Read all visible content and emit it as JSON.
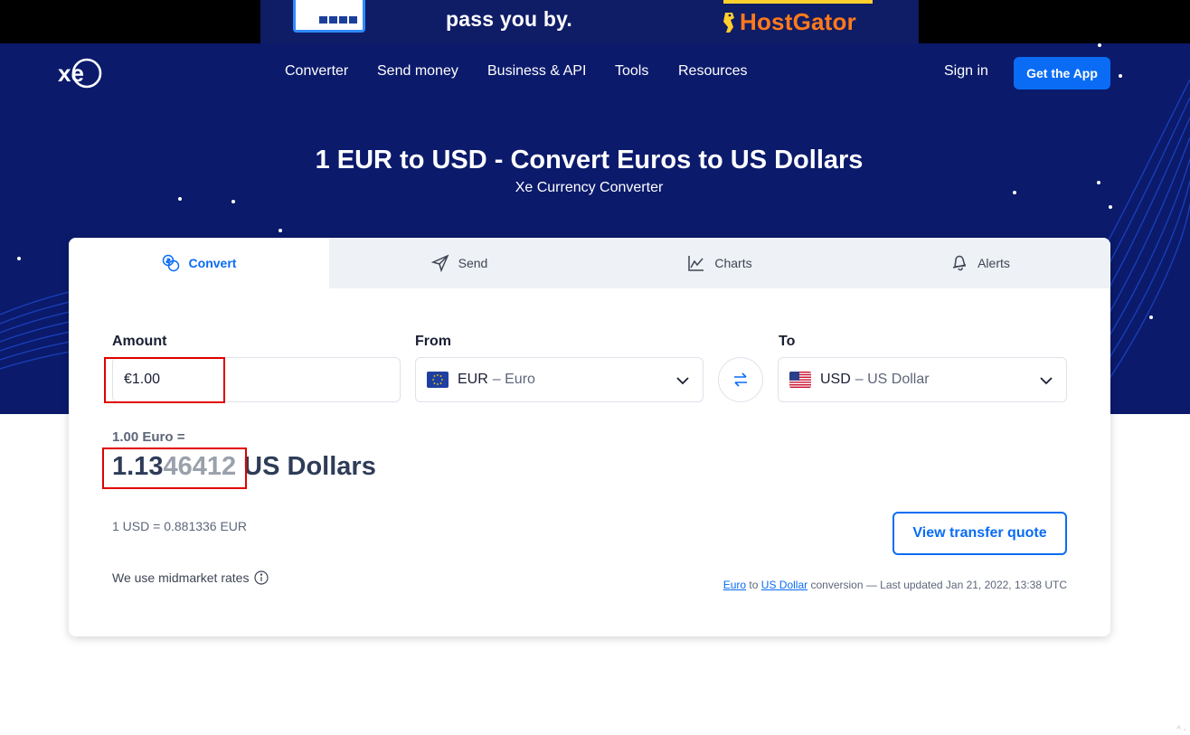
{
  "ad": {
    "headline": "pass you by.",
    "brand": "HostGator"
  },
  "header": {
    "nav": [
      "Converter",
      "Send money",
      "Business & API",
      "Tools",
      "Resources"
    ],
    "sign_in": "Sign in",
    "get_app": "Get the App"
  },
  "hero": {
    "title": "1 EUR to USD - Convert Euros to US Dollars",
    "subtitle": "Xe Currency Converter"
  },
  "tabs": [
    {
      "label": "Convert",
      "icon": "convert-icon",
      "active": true
    },
    {
      "label": "Send",
      "icon": "send-icon",
      "active": false
    },
    {
      "label": "Charts",
      "icon": "chart-icon",
      "active": false
    },
    {
      "label": "Alerts",
      "icon": "bell-icon",
      "active": false
    }
  ],
  "converter": {
    "amount_label": "Amount",
    "amount_value": "€1.00",
    "from_label": "From",
    "from_code": "EUR",
    "from_name": "– Euro",
    "to_label": "To",
    "to_code": "USD",
    "to_name": "– US Dollar"
  },
  "result": {
    "from_text": "1.00 Euro =",
    "value_main": "1.13",
    "value_dim": "46412",
    "unit": " US Dollars",
    "inverse_rate": "1 USD = 0.881336 EUR",
    "midmarket": "We use midmarket rates",
    "quote_button": "View transfer quote",
    "link_from": "Euro",
    "to_word": " to ",
    "link_to": "US Dollar",
    "updated_text": " conversion — Last updated Jan 21, 2022, 13:38 UTC"
  },
  "colors": {
    "hero_bg": "#0b1a6b",
    "accent": "#0a6cf5",
    "highlight": "#e00000"
  }
}
